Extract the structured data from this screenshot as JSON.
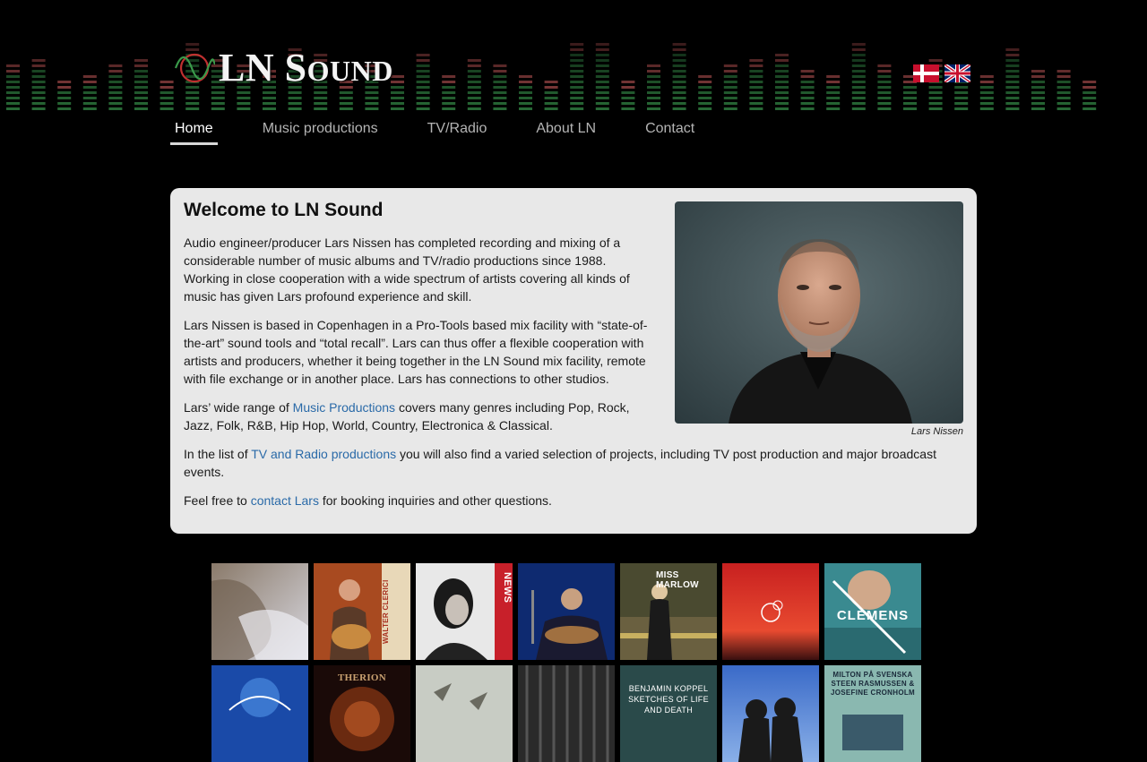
{
  "header": {
    "logo_big_l": "LN",
    "logo_big_s": "S",
    "logo_rest": "OUND",
    "languages": [
      "Dansk",
      "English"
    ]
  },
  "nav": {
    "items": [
      "Home",
      "Music productions",
      "TV/Radio",
      "About LN",
      "Contact"
    ],
    "active": "Home"
  },
  "main": {
    "title": "Welcome to LN Sound",
    "p1": "Audio engineer/producer Lars Nissen has completed recording and mixing of a considerable number of music albums and TV/radio productions since 1988. Working in close cooperation with a wide spectrum of artists covering all kinds of music has given Lars profound experience and skill.",
    "p2": "Lars Nissen is based in Copenhagen in a Pro-Tools based mix facility with “state-of-the-art” sound tools and “total recall”. Lars can thus offer a flexible cooperation with artists and producers, whether it being together in the LN Sound mix facility, remote with file exchange or in another place. Lars has connections to other studios.",
    "p3_before": "Lars’ wide range of ",
    "p3_link": "Music Productions",
    "p3_after": " covers many genres including Pop, Rock, Jazz, Folk, R&B, Hip Hop, World, Country, Electronica & Classical.",
    "p4_before": "In the list of ",
    "p4_link": "TV and Radio productions",
    "p4_after": " you will also find a varied selection of projects, including TV post production and major broadcast events.",
    "p5_before": "Feel free to ",
    "p5_link": "contact Lars",
    "p5_after": " for booking inquiries and other questions.",
    "caption": "Lars Nissen"
  },
  "albums": {
    "row1_text": [
      "",
      "WALTER CLERICI",
      "NEWS",
      "",
      "MISS MARLOW",
      "",
      "CLEMENS"
    ],
    "row2_text": [
      "",
      "THERION",
      "",
      "",
      "BENJAMIN KOPPEL SKETCHES OF LIFE AND DEATH",
      "",
      "MILTON PÅ SVENSKA STEEN RASMUSSEN & JOSEFINE CRONHOLM"
    ]
  },
  "colors": {
    "eq_green": "#2e7a3e",
    "eq_red": "#b05050",
    "link": "#2a6aa8",
    "box_bg": "#e8e8e8"
  }
}
